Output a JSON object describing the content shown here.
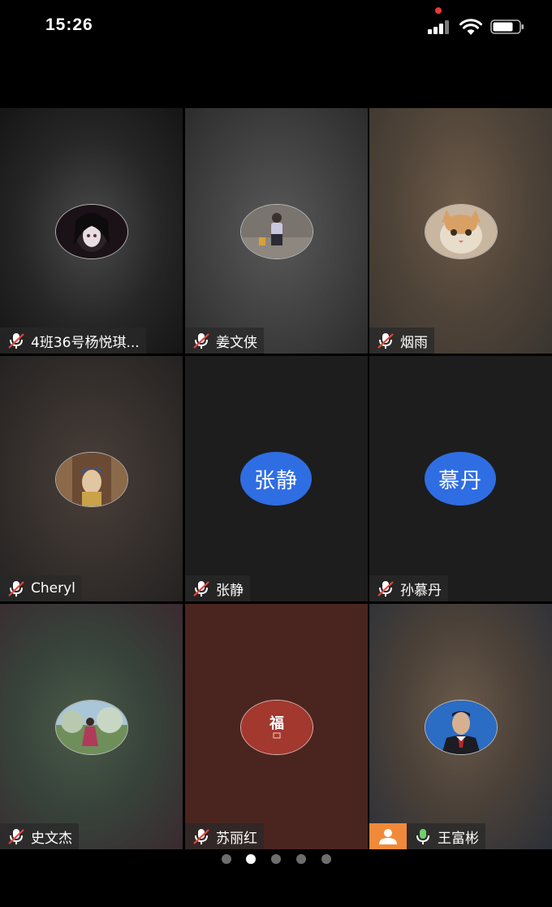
{
  "status_bar": {
    "time": "15:26",
    "signal_icon": "cellular-signal-icon",
    "wifi_icon": "wifi-icon",
    "battery_icon": "battery-icon",
    "recording_indicator_color": "#e53b30"
  },
  "participants": [
    {
      "name": "4班36号杨悦琪...",
      "avatar_type": "photo",
      "mic": "muted",
      "avatar_desc": "anime-girl-avatar"
    },
    {
      "name": "姜文侠",
      "avatar_type": "photo",
      "mic": "muted",
      "avatar_desc": "person-street-avatar"
    },
    {
      "name": "烟雨",
      "avatar_type": "photo",
      "mic": "muted",
      "avatar_desc": "cat-avatar"
    },
    {
      "name": "Cheryl",
      "avatar_type": "photo",
      "mic": "muted",
      "avatar_desc": "girl-with-pearl-earring-avatar"
    },
    {
      "name": "张静",
      "avatar_type": "text",
      "avatar_text": "张静",
      "mic": "muted"
    },
    {
      "name": "孙慕丹",
      "avatar_type": "text",
      "avatar_text": "慕丹",
      "mic": "muted"
    },
    {
      "name": "史文杰",
      "avatar_type": "photo",
      "mic": "muted",
      "avatar_desc": "woman-in-garden-avatar"
    },
    {
      "name": "苏丽红",
      "avatar_type": "photo",
      "mic": "muted",
      "avatar_desc": "fu-character-avatar",
      "avatar_glyph": "福"
    },
    {
      "name": "王富彬",
      "avatar_type": "photo",
      "mic": "active",
      "host": true,
      "avatar_desc": "man-in-suit-avatar"
    }
  ],
  "pagination": {
    "total": 5,
    "current": 2
  },
  "colors": {
    "text_avatar_bg": "#2f6de3",
    "host_badge": "#f08a3a",
    "mic_active": "#6fd16a",
    "mic_muted_slash": "#e0483c"
  }
}
